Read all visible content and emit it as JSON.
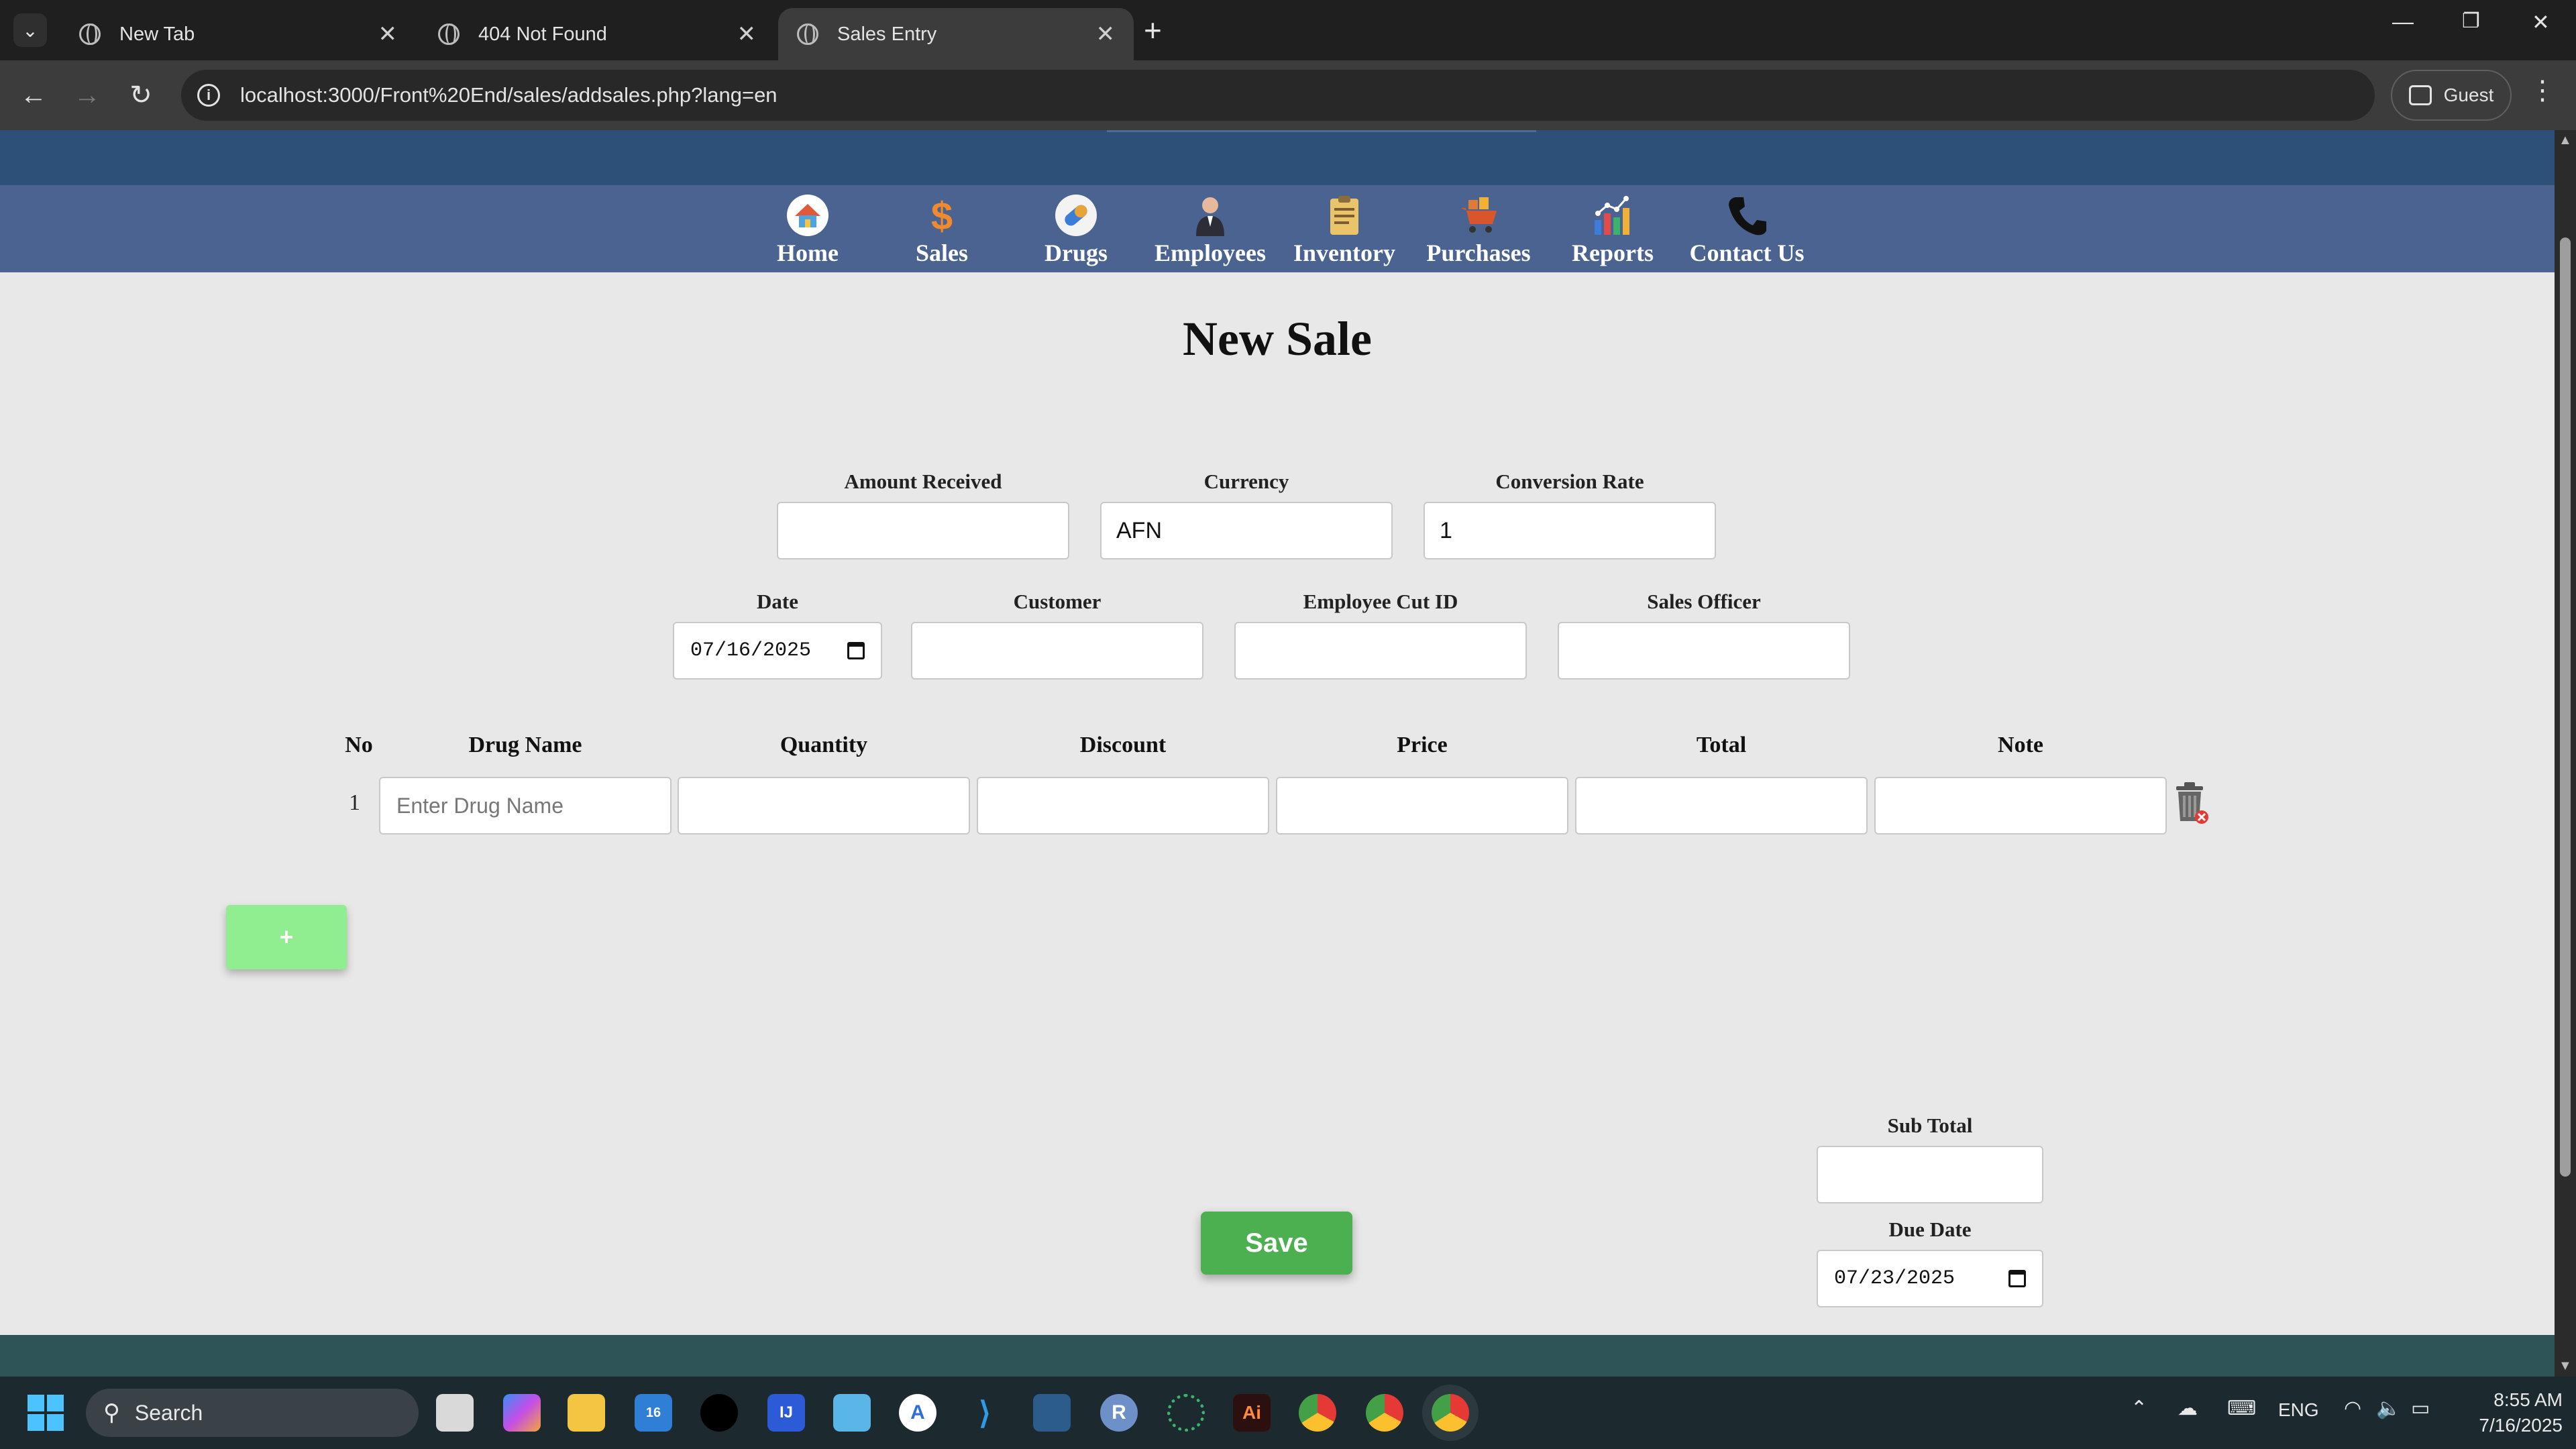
{
  "browser": {
    "tabs": [
      {
        "title": "New Tab",
        "active": false
      },
      {
        "title": "404 Not Found",
        "active": false
      },
      {
        "title": "Sales Entry",
        "active": true
      }
    ],
    "url": "localhost:3000/Front%20End/sales/addsales.php?lang=en",
    "profile_label": "Guest"
  },
  "nav": {
    "items": [
      {
        "label": "Home",
        "icon": "home-icon"
      },
      {
        "label": "Sales",
        "icon": "dollar-icon"
      },
      {
        "label": "Drugs",
        "icon": "pill-icon"
      },
      {
        "label": "Employees",
        "icon": "person-icon"
      },
      {
        "label": "Inventory",
        "icon": "clipboard-icon"
      },
      {
        "label": "Purchases",
        "icon": "cart-icon"
      },
      {
        "label": "Reports",
        "icon": "chart-icon"
      },
      {
        "label": "Contact Us",
        "icon": "phone-icon"
      }
    ]
  },
  "page": {
    "title": "New Sale"
  },
  "form": {
    "amount_received": {
      "label": "Amount Received",
      "value": ""
    },
    "currency": {
      "label": "Currency",
      "value": "AFN"
    },
    "conversion_rate": {
      "label": "Conversion Rate",
      "value": "1"
    },
    "date": {
      "label": "Date",
      "value": "07/16/2025"
    },
    "customer": {
      "label": "Customer",
      "value": ""
    },
    "employee_cut_id": {
      "label": "Employee Cut ID",
      "value": ""
    },
    "sales_officer": {
      "label": "Sales Officer",
      "value": ""
    }
  },
  "table": {
    "headers": [
      "No",
      "Drug Name",
      "Quantity",
      "Discount",
      "Price",
      "Total",
      "Note"
    ],
    "rows": [
      {
        "no": "1",
        "drug_name_placeholder": "Enter Drug Name"
      }
    ]
  },
  "add_row_label": "+",
  "summary": {
    "sub_total": {
      "label": "Sub Total",
      "value": ""
    },
    "due_date": {
      "label": "Due Date",
      "value": "07/23/2025"
    }
  },
  "save_label": "Save",
  "taskbar": {
    "search_label": "Search",
    "badge_count": "16",
    "language": "ENG",
    "time": "8:55 AM",
    "date": "7/16/2025"
  },
  "colors": {
    "nav_bg": "#4a6390",
    "top_band": "#2d5078",
    "add_button": "#90ee90",
    "save_button": "#4caf50",
    "footer": "#2e5457"
  }
}
